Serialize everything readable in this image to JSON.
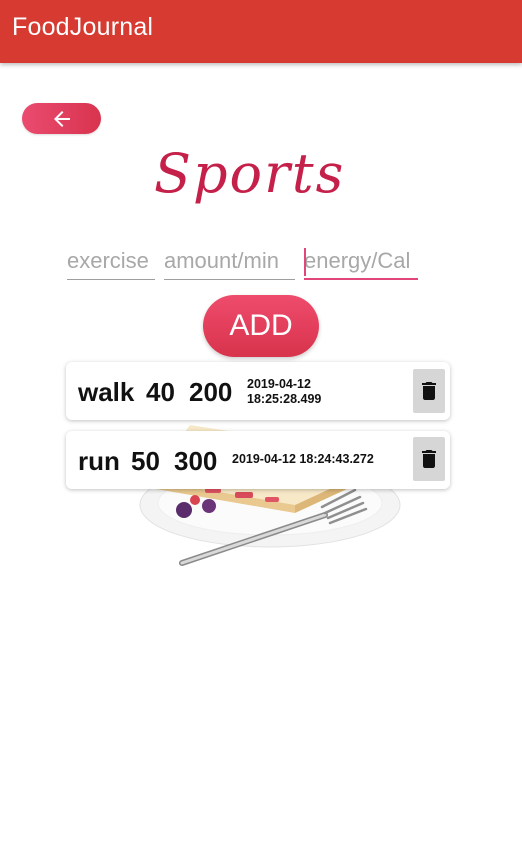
{
  "appbar": {
    "title": "FoodJournal",
    "color": "#d63a31"
  },
  "page": {
    "title": "Sports"
  },
  "form": {
    "exercise_placeholder": "exercise",
    "amount_placeholder": "amount/min",
    "energy_placeholder": "energy/Cal",
    "add_label": "ADD"
  },
  "entries": [
    {
      "exercise": "walk",
      "amount": "40",
      "energy": "200",
      "date": "2019-04-12",
      "time": "18:25:28.499"
    },
    {
      "exercise": "run",
      "amount": "50",
      "energy": "300",
      "datetime": "2019-04-12 18:24:43.272"
    }
  ],
  "icons": {
    "back": "arrow-left-icon",
    "delete": "trash-icon"
  },
  "colors": {
    "accent": "#e0467a",
    "button": "#d8344f"
  }
}
